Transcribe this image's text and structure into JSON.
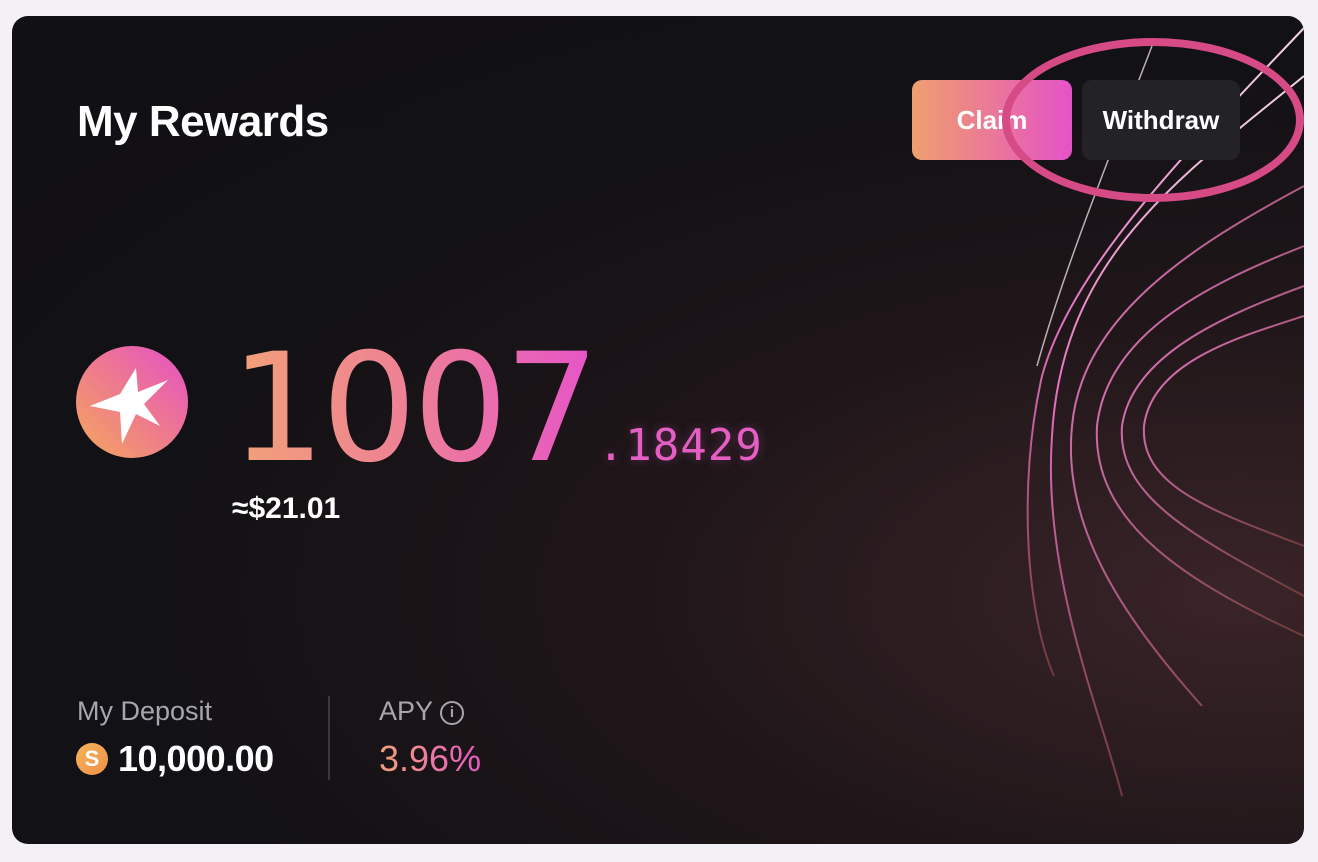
{
  "card": {
    "title": "My Rewards"
  },
  "actions": {
    "claim_label": "Claim",
    "withdraw_label": "Withdraw"
  },
  "rewards": {
    "token_icon": "sparkle-star-icon",
    "amount_integer": "1007",
    "amount_decimal": ".18429",
    "usd_value": "≈$21.01"
  },
  "deposit": {
    "label": "My Deposit",
    "currency_icon": "s-coin-icon",
    "currency_glyph": "S",
    "value": "10,000.00"
  },
  "apy": {
    "label": "APY",
    "info_icon": "info-icon",
    "info_glyph": "i",
    "value": "3.96%"
  },
  "colors": {
    "accent_start": "#ef9f6f",
    "accent_end": "#e553c9",
    "annotation_ring": "#d64a86",
    "card_background": "#111014",
    "withdraw_button": "#222227"
  }
}
